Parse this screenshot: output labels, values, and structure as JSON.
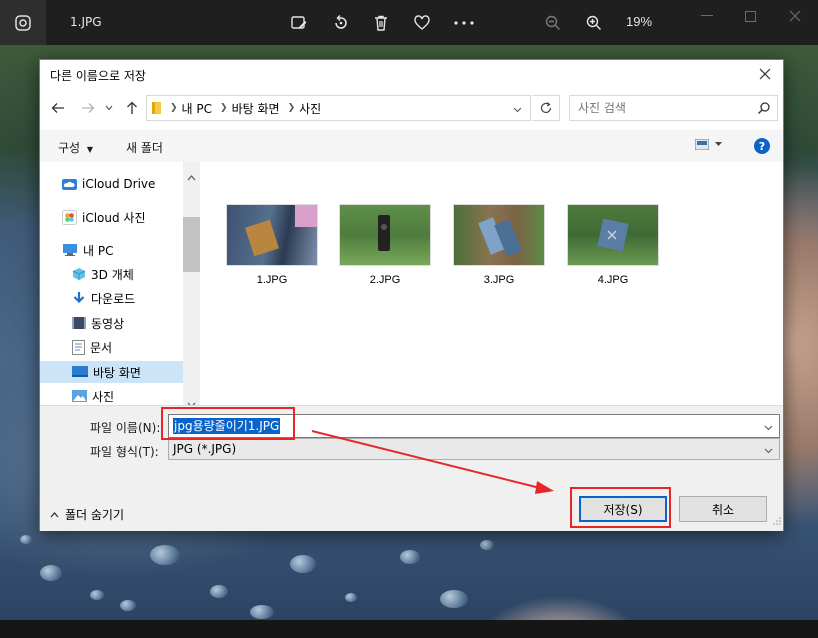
{
  "viewer": {
    "file_name": "1.JPG",
    "zoom": "19%"
  },
  "dialog": {
    "title": "다른 이름으로 저장",
    "breadcrumb": [
      "내 PC",
      "바탕 화면",
      "사진"
    ],
    "search_placeholder": "사진 검색",
    "toolbar": {
      "organize": "구성",
      "new_folder": "새 폴더"
    },
    "nav_items": [
      {
        "label": "iCloud Drive",
        "icon": "icloud-drive-icon"
      },
      {
        "label": "iCloud 사진",
        "icon": "icloud-photos-icon"
      },
      {
        "label": "내 PC",
        "icon": "pc-icon"
      },
      {
        "label": "3D 개체",
        "icon": "3d-objects-icon"
      },
      {
        "label": "다운로드",
        "icon": "download-icon"
      },
      {
        "label": "동영상",
        "icon": "video-icon"
      },
      {
        "label": "문서",
        "icon": "document-icon"
      },
      {
        "label": "바탕 화면",
        "icon": "desktop-icon",
        "selected": true
      },
      {
        "label": "사진",
        "icon": "pictures-icon"
      }
    ],
    "files": [
      {
        "name": "1.JPG"
      },
      {
        "name": "2.JPG"
      },
      {
        "name": "3.JPG"
      },
      {
        "name": "4.JPG"
      }
    ],
    "file_name_label": "파일 이름(N):",
    "file_name_value": "jpg용량줄이기1.JPG",
    "file_type_label": "파일 형식(T):",
    "file_type_value": "JPG (*.JPG)",
    "hide_folders": "폴더 숨기기",
    "save_button": "저장(S)",
    "cancel_button": "취소"
  },
  "colors": {
    "accent": "#0a63c9",
    "highlight": "#e8262a"
  }
}
